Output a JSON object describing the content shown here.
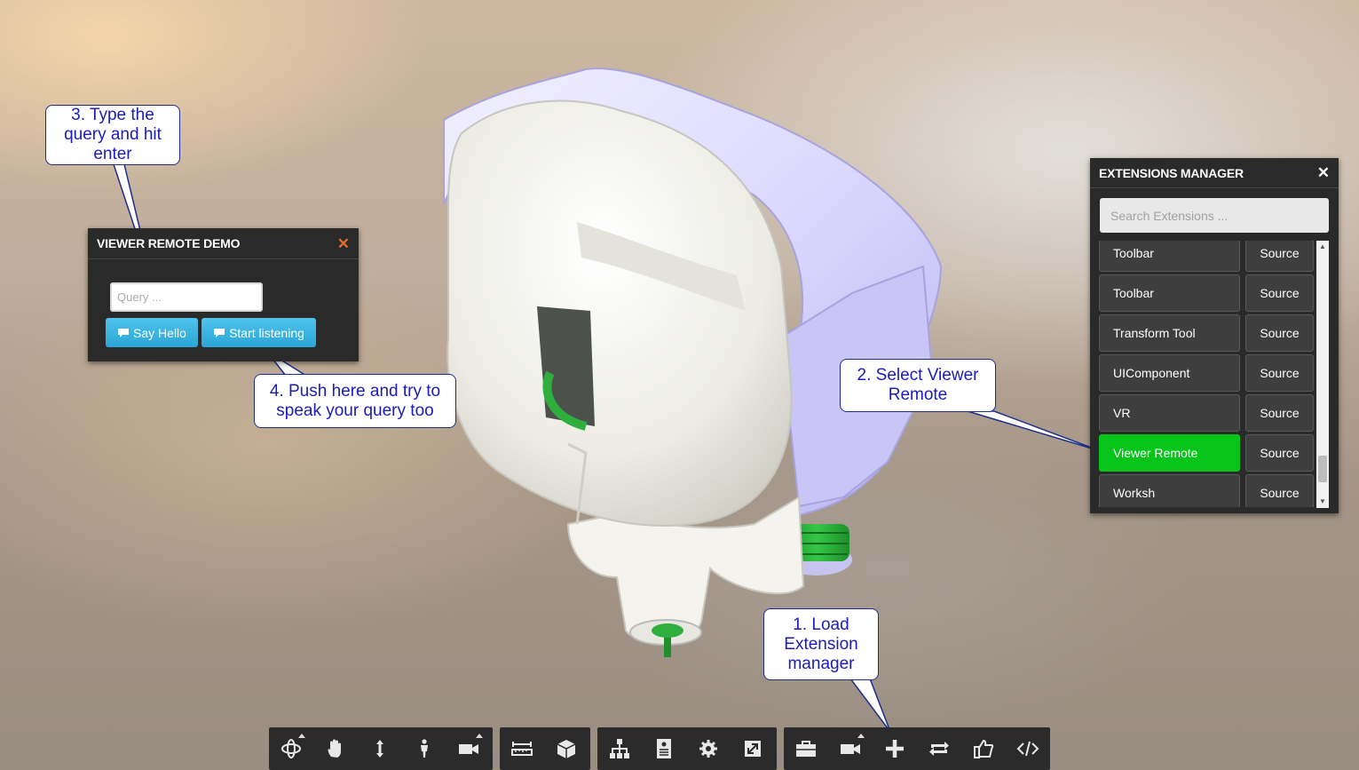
{
  "remote_panel": {
    "title": "VIEWER REMOTE DEMO",
    "close_icon": "close-icon",
    "query_placeholder": "Query ...",
    "say_hello_label": "Say Hello",
    "start_listening_label": "Start listening"
  },
  "extensions_panel": {
    "title": "EXTENSIONS MANAGER",
    "close_icon": "close-icon",
    "search_placeholder": "Search Extensions ...",
    "items": [
      {
        "name": "Toolbar",
        "source": "Source",
        "selected": false
      },
      {
        "name": "Toolbar",
        "source": "Source",
        "selected": false
      },
      {
        "name": "Transform Tool",
        "source": "Source",
        "selected": false
      },
      {
        "name": "UIComponent",
        "source": "Source",
        "selected": false
      },
      {
        "name": "VR",
        "source": "Source",
        "selected": false
      },
      {
        "name": "Viewer Remote",
        "source": "Source",
        "selected": true
      },
      {
        "name": "Worksh",
        "source": "Source",
        "selected": false
      }
    ],
    "selected_color": "#06c41a"
  },
  "callouts": {
    "step1": "1. Load\nExtension\nmanager",
    "step2": "2. Select Viewer\nRemote",
    "step3": "3. Type the\nquery and hit\nenter",
    "step4": "4. Push here and try to\nspeak your query too"
  },
  "toolbar": {
    "groups": [
      [
        "orbit-icon",
        "pan-icon",
        "dolly-icon",
        "first-person-icon",
        "camera-icon"
      ],
      [
        "measure-icon",
        "section-box-icon"
      ],
      [
        "model-structure-icon",
        "properties-icon",
        "settings-icon",
        "fullscreen-icon"
      ],
      [
        "extensions-briefcase-icon",
        "video-camera-icon",
        "add-extension-icon",
        "loop-icon",
        "like-icon",
        "code-icon"
      ]
    ]
  }
}
